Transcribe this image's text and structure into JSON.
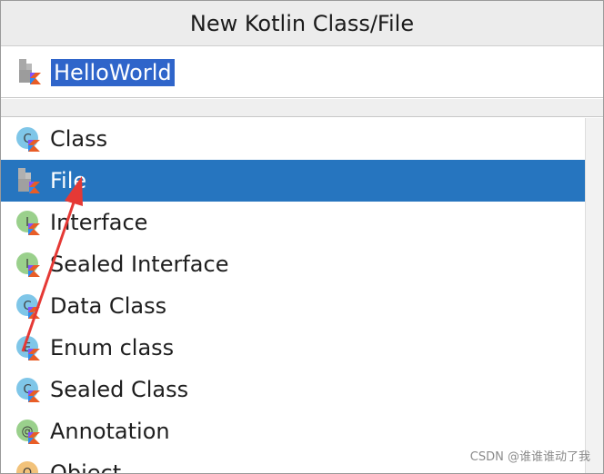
{
  "dialog": {
    "title": "New Kotlin Class/File"
  },
  "name_field": {
    "value": "HelloWorld",
    "icon": "kotlin-file-icon"
  },
  "templates": [
    {
      "label": "Class",
      "icon": "kotlin-class-icon",
      "letter": "C",
      "selected": false
    },
    {
      "label": "File",
      "icon": "kotlin-file-icon",
      "letter": "",
      "selected": true
    },
    {
      "label": "Interface",
      "icon": "kotlin-interface-icon",
      "letter": "I",
      "selected": false
    },
    {
      "label": "Sealed Interface",
      "icon": "kotlin-interface-icon",
      "letter": "I",
      "selected": false
    },
    {
      "label": "Data Class",
      "icon": "kotlin-class-icon",
      "letter": "C",
      "selected": false
    },
    {
      "label": "Enum class",
      "icon": "kotlin-enum-icon",
      "letter": "E",
      "selected": false
    },
    {
      "label": "Sealed Class",
      "icon": "kotlin-class-icon",
      "letter": "C",
      "selected": false
    },
    {
      "label": "Annotation",
      "icon": "kotlin-annotation-icon",
      "letter": "@",
      "selected": false
    },
    {
      "label": "Object",
      "icon": "kotlin-object-icon",
      "letter": "O",
      "selected": false
    }
  ],
  "colors": {
    "selection": "#2675bf",
    "input_selection": "#2f65ca",
    "annotation_arrow": "#e53935"
  },
  "watermark": "CSDN @谁谁谁动了我"
}
